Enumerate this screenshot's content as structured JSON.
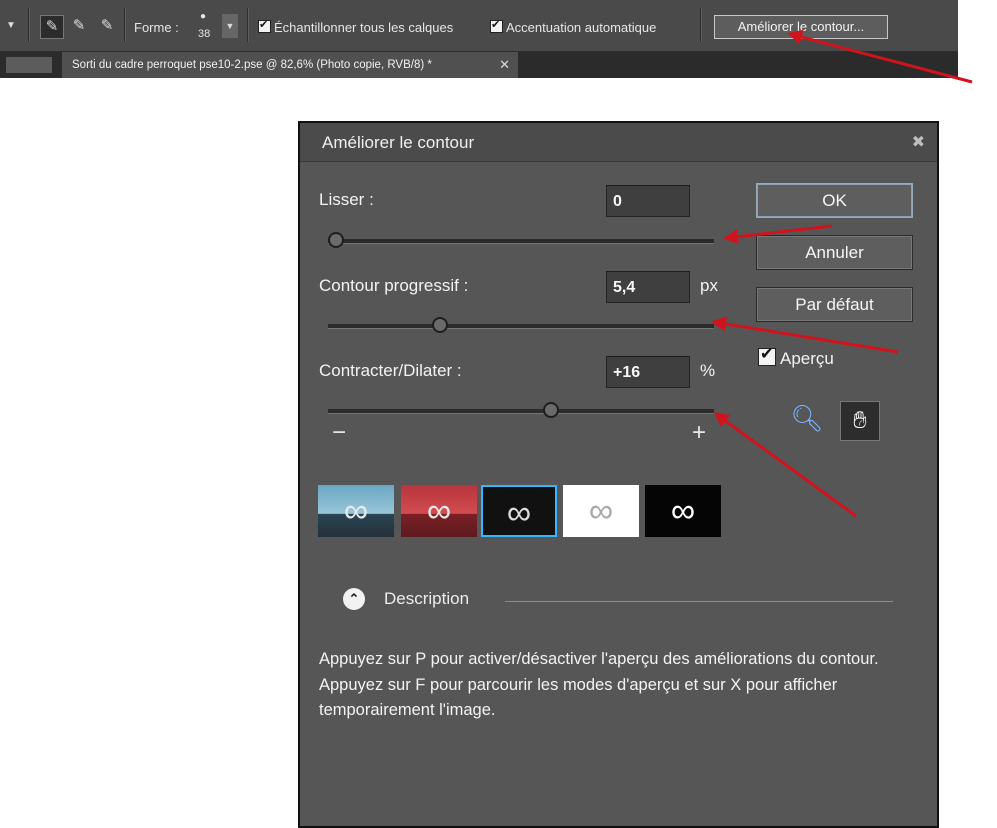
{
  "toolbar": {
    "forme_label": "Forme :",
    "brush_size": "38",
    "sample_all_layers": "Échantillonner tous les calques",
    "auto_enhance": "Accentuation automatique",
    "refine_edge_button": "Améliorer le contour..."
  },
  "document_tab": {
    "title": "Sorti du cadre perroquet pse10-2.pse @ 82,6% (Photo copie, RVB/8) *"
  },
  "dialog": {
    "title": "Améliorer le contour",
    "smooth": {
      "label": "Lisser :",
      "value": "0",
      "slider_fraction": 0.0
    },
    "feather": {
      "label": "Contour progressif :",
      "value": "5,4",
      "unit": "px",
      "slider_fraction": 0.28
    },
    "contract_expand": {
      "label": "Contracter/Dilater :",
      "value": "+16",
      "unit": "%",
      "slider_fraction": 0.58,
      "min_symbol": "−",
      "max_symbol": "+"
    },
    "buttons": {
      "ok": "OK",
      "cancel": "Annuler",
      "default": "Par défaut"
    },
    "preview_label": "Aperçu",
    "description": {
      "title": "Description",
      "text": "Appuyez sur P pour activer/désactiver l'aperçu des améliorations du contour. Appuyez sur F pour parcourir les modes d'aperçu et sur X pour afficher temporairement l'image."
    }
  },
  "colors": {
    "panel": "#565656",
    "toolbar": "#4a4a4a",
    "selected_mode_border": "#35b7ff",
    "annotation_arrow": "#d0131c"
  }
}
